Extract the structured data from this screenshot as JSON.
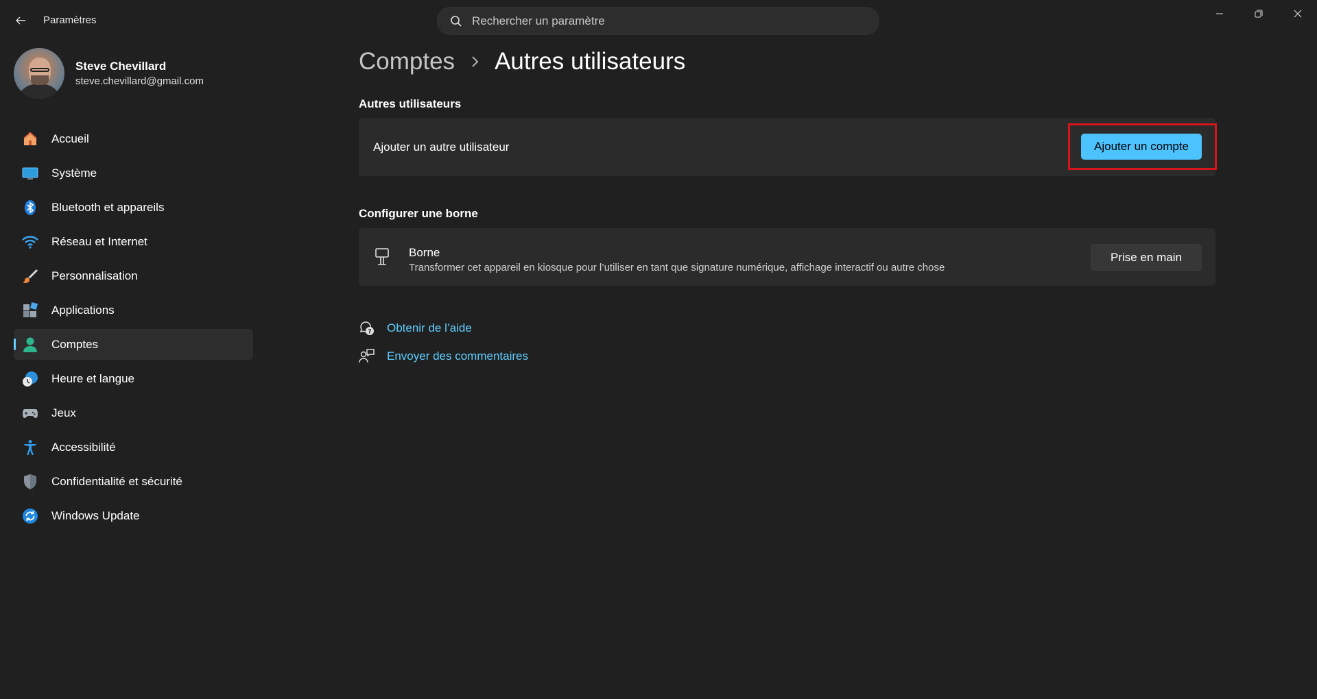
{
  "window": {
    "title": "Paramètres"
  },
  "search": {
    "placeholder": "Rechercher un paramètre"
  },
  "profile": {
    "name": "Steve Chevillard",
    "email": "steve.chevillard@gmail.com"
  },
  "sidebar": {
    "items": [
      {
        "label": "Accueil",
        "icon": "home-icon"
      },
      {
        "label": "Système",
        "icon": "display-icon"
      },
      {
        "label": "Bluetooth et appareils",
        "icon": "bluetooth-icon"
      },
      {
        "label": "Réseau et Internet",
        "icon": "wifi-icon"
      },
      {
        "label": "Personnalisation",
        "icon": "brush-icon"
      },
      {
        "label": "Applications",
        "icon": "apps-icon"
      },
      {
        "label": "Comptes",
        "icon": "user-icon",
        "active": true
      },
      {
        "label": "Heure et langue",
        "icon": "clock-globe-icon"
      },
      {
        "label": "Jeux",
        "icon": "gamepad-icon"
      },
      {
        "label": "Accessibilité",
        "icon": "accessibility-icon"
      },
      {
        "label": "Confidentialité et sécurité",
        "icon": "shield-icon"
      },
      {
        "label": "Windows Update",
        "icon": "update-icon"
      }
    ]
  },
  "breadcrumb": {
    "parent": "Comptes",
    "current": "Autres utilisateurs"
  },
  "other_users": {
    "section_title": "Autres utilisateurs",
    "row_label": "Ajouter un autre utilisateur",
    "button_label": "Ajouter un compte"
  },
  "kiosk": {
    "section_title": "Configurer une borne",
    "title": "Borne",
    "description": "Transformer cet appareil en kiosque pour l’utiliser en tant que signature numérique, affichage interactif ou autre chose",
    "button_label": "Prise en main"
  },
  "links": {
    "help": "Obtenir de l’aide",
    "feedback": "Envoyer des commentaires"
  },
  "colors": {
    "accent": "#4cc2ff",
    "link": "#60cdff",
    "highlight_box": "#d6141c",
    "background": "#202020",
    "card": "#2b2b2b"
  }
}
